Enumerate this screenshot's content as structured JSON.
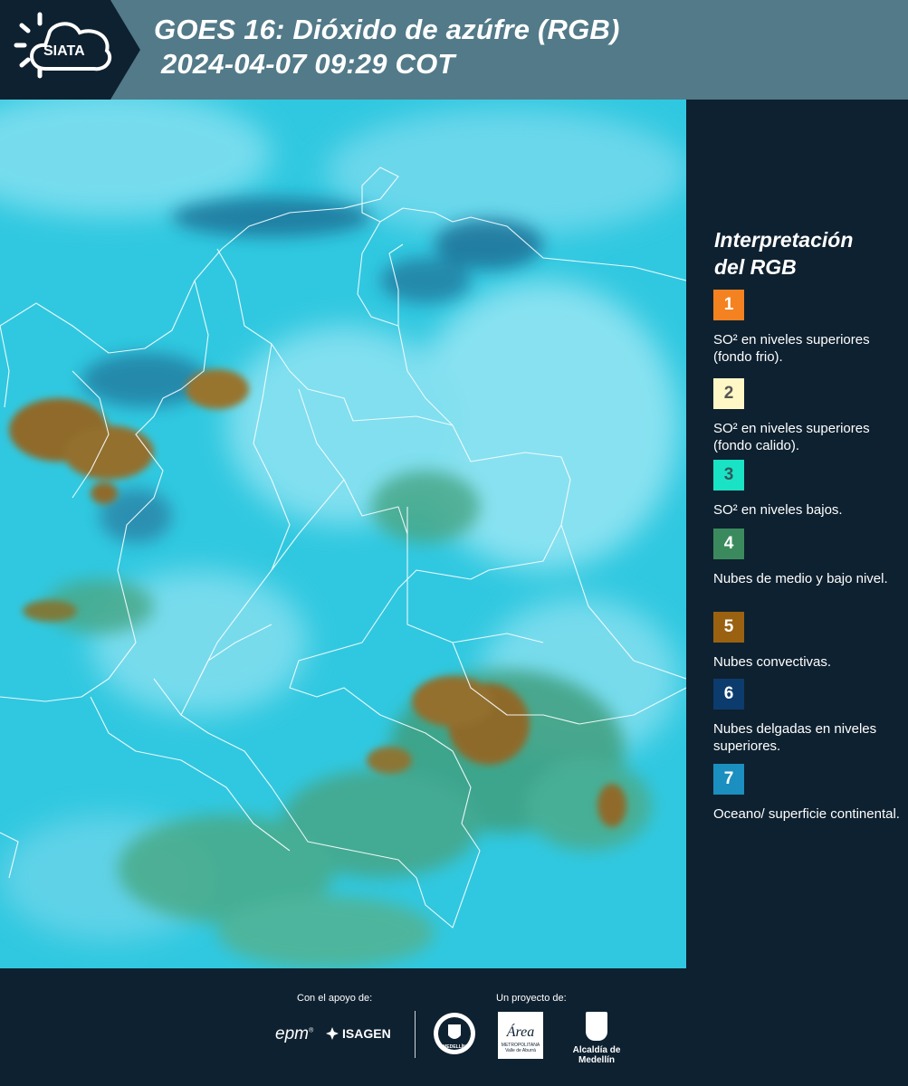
{
  "header": {
    "logo_text": "SIATA",
    "title_line1": "GOES 16: Dióxido de azúfre (RGB)",
    "title_line2": "2024-04-07 09:29 COT"
  },
  "legend": {
    "title_line1": "Interpretación",
    "title_line2": "del RGB",
    "items": [
      {
        "number": "1",
        "color": "#f58220",
        "number_color": "#ffffff",
        "label": "SO² en niveles superiores (fondo frio)."
      },
      {
        "number": "2",
        "color": "#fff8c6",
        "number_color": "#555555",
        "label": "SO² en niveles superiores (fondo calido)."
      },
      {
        "number": "3",
        "color": "#19e3c4",
        "number_color": "#2f5a5a",
        "label": "SO² en niveles bajos."
      },
      {
        "number": "4",
        "color": "#3b8a5e",
        "number_color": "#ffffff",
        "label": "Nubes de medio y bajo nivel."
      },
      {
        "number": "5",
        "color": "#9a6210",
        "number_color": "#ffffff",
        "label": "Nubes convectivas."
      },
      {
        "number": "6",
        "color": "#0c3b6e",
        "number_color": "#ffffff",
        "label": "Nubes delgadas en niveles superiores."
      },
      {
        "number": "7",
        "color": "#1b8fbf",
        "number_color": "#ffffff",
        "label": "Oceano/ superficie continental."
      }
    ]
  },
  "footer": {
    "support_label": "Con el apoyo de:",
    "project_label": "Un proyecto de:",
    "sponsor_epm": "epm",
    "sponsor_isagen": "ISAGEN",
    "logo_medellin_text": "MEDELLÍN",
    "logo_area_text": "Área",
    "logo_area_sub1": "METROPOLITANA",
    "logo_area_sub2": "Valle de Aburrá",
    "logo_alcaldia_text": "Alcaldía de Medellín"
  },
  "colors": {
    "header_bg": "#527a89",
    "panel_bg": "#0e2130",
    "map_base": "#30c8e0"
  }
}
